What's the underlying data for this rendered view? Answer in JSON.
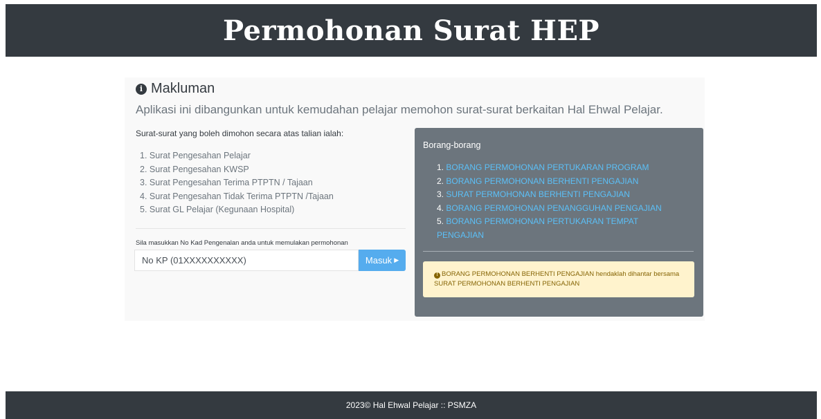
{
  "header": {
    "title": "Permohonan Surat HEP"
  },
  "info": {
    "icon": "info-circle-icon",
    "title": "Makluman",
    "lead": "Aplikasi ini dibangunkan untuk kemudahan pelajar memohon surat-surat berkaitan Hal Ehwal Pelajar."
  },
  "surat": {
    "intro": "Surat-surat yang boleh dimohon secara atas talian ialah:",
    "items": [
      {
        "num": "1.",
        "label": "Surat Pengesahan Pelajar"
      },
      {
        "num": "2.",
        "label": "Surat Pengesahan KWSP"
      },
      {
        "num": "3.",
        "label": "Surat Pengesahan Terima PTPTN / Tajaan"
      },
      {
        "num": "4.",
        "label": "Surat Pengesahan Tidak Terima PTPTN /Tajaan"
      },
      {
        "num": "5.",
        "label": "Surat GL Pelajar (Kegunaan Hospital)"
      }
    ]
  },
  "form": {
    "label": "Sila masukkan No Kad Pengenalan anda untuk memulakan permohonan",
    "placeholder": "No KP (01XXXXXXXXXX)",
    "button_label": "Masuk",
    "button_icon": "caret-right-icon"
  },
  "borang": {
    "title": "Borang-borang",
    "items": [
      {
        "num": "1.",
        "label": "BORANG PERMOHONAN PERTUKARAN PROGRAM"
      },
      {
        "num": "2.",
        "label": "BORANG PERMOHONAN BERHENTI PENGAJIAN"
      },
      {
        "num": "3.",
        "label": "SURAT PERMOHONAN BERHENTI PENGAJIAN"
      },
      {
        "num": "4.",
        "label": "BORANG PERMOHONAN PENANGGUHAN PENGAJIAN"
      },
      {
        "num": "5.",
        "label": "BORANG PERMOHONAN PERTUKARAN TEMPAT PENGAJIAN"
      }
    ],
    "alert_icon": "info-circle-icon",
    "alert_text": "BORANG PERMOHONAN BERHENTI PENGAJIAN hendaklah dihantar bersama SURAT PERMOHONAN BERHENTI PENGAJIAN"
  },
  "footer": {
    "text": "2023© Hal Ehwal Pelajar :: PSMZA"
  },
  "colors": {
    "dark": "#343a40",
    "card": "#6c757d",
    "link": "#5bc0f8",
    "button": "#55acee",
    "alert_bg": "#fff3cd",
    "alert_text": "#856404"
  }
}
